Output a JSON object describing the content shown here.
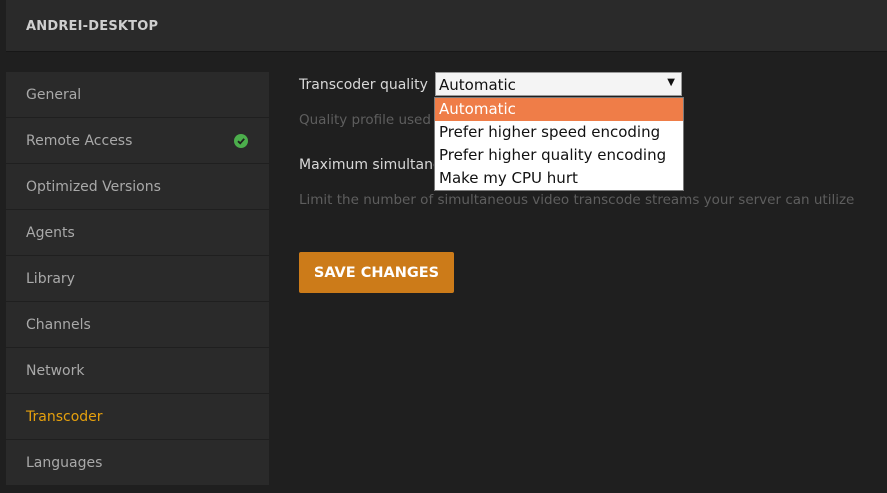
{
  "header": {
    "server_name": "ANDREI-DESKTOP"
  },
  "sidebar": {
    "items": [
      {
        "label": "General",
        "active": false
      },
      {
        "label": "Remote Access",
        "active": false,
        "status": "ok"
      },
      {
        "label": "Optimized Versions",
        "active": false
      },
      {
        "label": "Agents",
        "active": false
      },
      {
        "label": "Library",
        "active": false
      },
      {
        "label": "Channels",
        "active": false
      },
      {
        "label": "Network",
        "active": false
      },
      {
        "label": "Transcoder",
        "active": true
      },
      {
        "label": "Languages",
        "active": false
      }
    ]
  },
  "settings": {
    "transcoder_quality": {
      "label": "Transcoder quality",
      "value": "Automatic",
      "help_visible": "Quality profile used b",
      "options": [
        "Automatic",
        "Prefer higher speed encoding",
        "Prefer higher quality encoding",
        "Make my CPU hurt"
      ],
      "selected_index": 0
    },
    "max_transcode": {
      "label_visible": "Maximum simultane",
      "help": "Limit the number of simultaneous video transcode streams your server can utilize"
    }
  },
  "actions": {
    "save_label": "SAVE CHANGES"
  },
  "colors": {
    "accent": "#e5a00d",
    "button": "#cc7b19",
    "option_highlight": "#ef7d48",
    "status_ok": "#4cae4c"
  }
}
